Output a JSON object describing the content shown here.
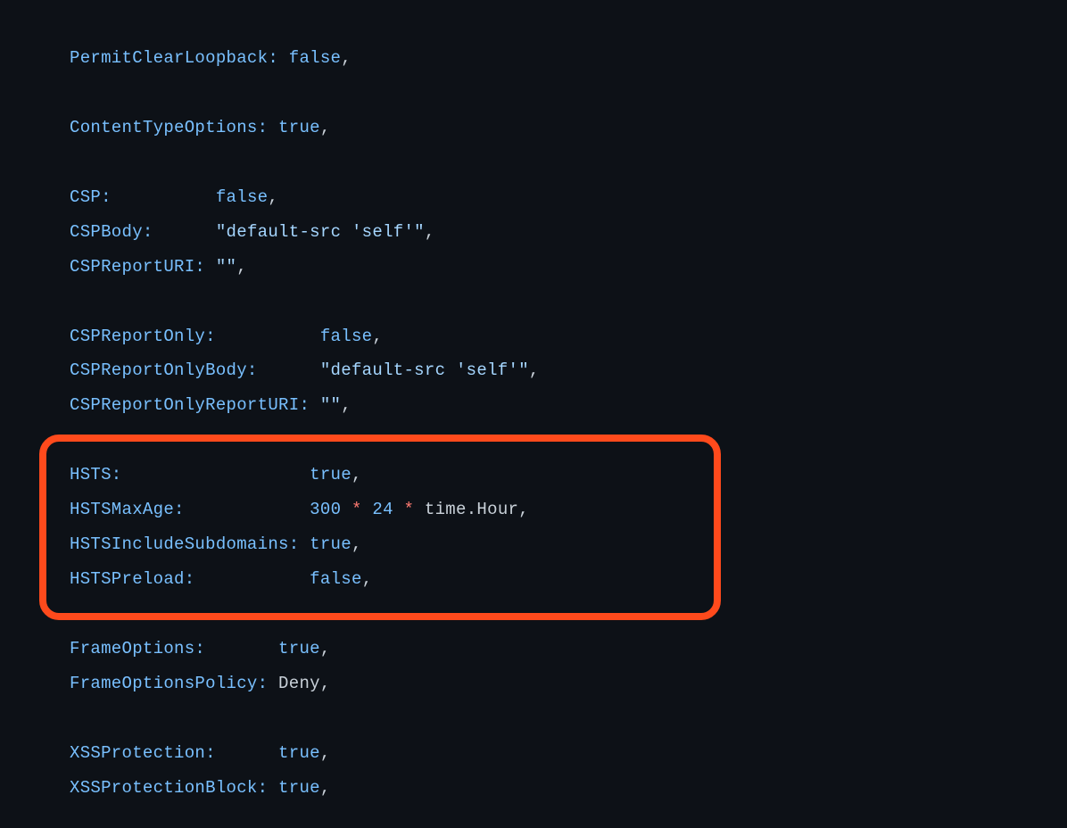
{
  "lines": {
    "l1_key": "PermitClearLoopback:",
    "l1_pad": " ",
    "l1_val": "false",
    "l1_end": ",",
    "l2": "",
    "l3_key": "ContentTypeOptions:",
    "l3_pad": " ",
    "l3_val": "true",
    "l3_end": ",",
    "l4": "",
    "l5_key": "CSP:",
    "l5_pad": "          ",
    "l5_val": "false",
    "l5_end": ",",
    "l6_key": "CSPBody:",
    "l6_pad": "      ",
    "l6_val": "\"default-src 'self'\"",
    "l6_end": ",",
    "l7_key": "CSPReportURI:",
    "l7_pad": " ",
    "l7_val": "\"\"",
    "l7_end": ",",
    "l8": "",
    "l9_key": "CSPReportOnly:",
    "l9_pad": "          ",
    "l9_val": "false",
    "l9_end": ",",
    "l10_key": "CSPReportOnlyBody:",
    "l10_pad": "      ",
    "l10_val": "\"default-src 'self'\"",
    "l10_end": ",",
    "l11_key": "CSPReportOnlyReportURI:",
    "l11_pad": " ",
    "l11_val": "\"\"",
    "l11_end": ",",
    "l12": "",
    "l13_key": "HSTS:",
    "l13_pad": "                  ",
    "l13_val": "true",
    "l13_end": ",",
    "l14_key": "HSTSMaxAge:",
    "l14_pad": "            ",
    "l14_n1": "300",
    "l14_op1": " * ",
    "l14_n2": "24",
    "l14_op2": " * ",
    "l14_rest": "time.Hour,",
    "l15_key": "HSTSIncludeSubdomains:",
    "l15_pad": " ",
    "l15_val": "true",
    "l15_end": ",",
    "l16_key": "HSTSPreload:",
    "l16_pad": "           ",
    "l16_val": "false",
    "l16_end": ",",
    "l17": "",
    "l18_key": "FrameOptions:",
    "l18_pad": "       ",
    "l18_val": "true",
    "l18_end": ",",
    "l19_key": "FrameOptionsPolicy:",
    "l19_pad": " ",
    "l19_val": "Deny,",
    "l20": "",
    "l21_key": "XSSProtection:",
    "l21_pad": "      ",
    "l21_val": "true",
    "l21_end": ",",
    "l22_key": "XSSProtectionBlock:",
    "l22_pad": " ",
    "l22_val": "true",
    "l22_end": ","
  }
}
